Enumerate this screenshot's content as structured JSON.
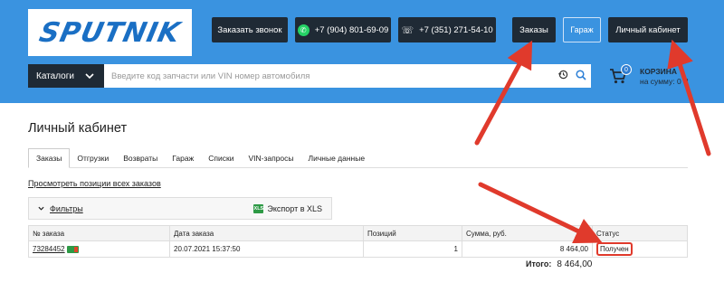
{
  "header": {
    "logo_text": "SPUTNIK",
    "callback_label": "Заказать звонок",
    "phone_whatsapp": "+7 (904) 801-69-09",
    "phone_main": "+7 (351) 271-54-10",
    "orders_label": "Заказы",
    "garage_label": "Гараж",
    "account_label": "Личный кабинет",
    "catalog_label": "Каталоги",
    "search_placeholder": "Введите код запчасти или VIN номер автомобиля",
    "cart": {
      "count": "0",
      "title": "КОРЗИНА",
      "sum_label": "на сумму: 0 ₽"
    }
  },
  "page": {
    "title": "Личный кабинет",
    "tabs": [
      "Заказы",
      "Отгрузки",
      "Возвраты",
      "Гараж",
      "Списки",
      "VIN-запросы",
      "Личные данные"
    ],
    "view_all_link": "Просмотреть позиции всех заказов",
    "filters_label": "Фильтры",
    "export_label": "Экспорт в XLS",
    "xls_icon_text": "XLS"
  },
  "table": {
    "columns": [
      "№ заказа",
      "Дата заказа",
      "Позиций",
      "Сумма, руб.",
      "Статус"
    ],
    "rows": [
      {
        "order_no": "73284452",
        "date": "20.07.2021 15:37:50",
        "positions": "1",
        "sum": "8 464,00",
        "status": "Получен"
      }
    ],
    "total_label": "Итого:",
    "total_value": "8 464,00"
  },
  "colors": {
    "header_bg": "#3a93e0",
    "dark_button": "#1f2a35",
    "annotation_red": "#e03a2c"
  }
}
